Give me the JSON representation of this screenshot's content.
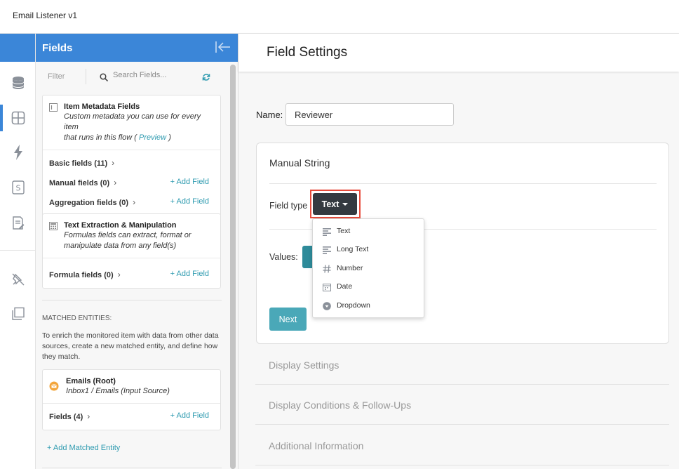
{
  "app": {
    "title": "Email Listener v1"
  },
  "colors": {
    "accent": "#3b86d8",
    "link": "#2f9bb0",
    "highlight": "#e74c3c",
    "dark_button": "#343a40",
    "teal_button": "#4aa8b8"
  },
  "rail": {
    "icons": [
      "database-icon",
      "table-icon",
      "lightning-icon",
      "s-box-icon",
      "edit-document-icon",
      "pin-off-icon",
      "copy-icon"
    ],
    "active": "table-icon"
  },
  "fields_panel": {
    "title": "Fields",
    "filter_label": "Filter",
    "search_placeholder": "Search Fields...",
    "metadata_card": {
      "title": "Item Metadata Fields",
      "desc_1": "Custom metadata you can use for every item",
      "desc_2a": "that runs in this flow (",
      "preview": "Preview",
      "desc_2b": ")",
      "rows": [
        {
          "label": "Basic fields (11)",
          "add": ""
        },
        {
          "label": "Manual fields (0)",
          "add": "+ Add Field"
        },
        {
          "label": "Aggregation fields (0)",
          "add": "+ Add Field"
        }
      ]
    },
    "text_card": {
      "title": "Text Extraction & Manipulation",
      "desc_1": "Formulas fields can extract, format or",
      "desc_2": "manipulate data from any field(s)",
      "row": {
        "label": "Formula fields (0)",
        "add": "+ Add Field"
      }
    },
    "matched": {
      "title": "MATCHED ENTITIES:",
      "desc": "To enrich the monitored item with data from other data sources, create a new matched entity, and define how they match.",
      "entity_title": "Emails (Root)",
      "entity_desc": "Inbox1 / Emails (Input Source)",
      "row": {
        "label": "Fields (4)",
        "add": "+ Add Field"
      },
      "add_matched": "+ Add Matched Entity"
    }
  },
  "settings": {
    "title": "Field Settings",
    "name_label": "Name:",
    "name_value": "Reviewer",
    "box_title": "Manual String",
    "field_type_label": "Field type",
    "field_type_value": "Text",
    "values_label": "Values:",
    "next_label": "Next",
    "type_options": [
      {
        "label": "Text",
        "icon": "text-lines-icon"
      },
      {
        "label": "Long Text",
        "icon": "long-text-icon"
      },
      {
        "label": "Number",
        "icon": "hash-icon"
      },
      {
        "label": "Date",
        "icon": "calendar-icon"
      },
      {
        "label": "Dropdown",
        "icon": "dropdown-circle-icon"
      }
    ],
    "accordions": [
      "Display Settings",
      "Display Conditions & Follow-Ups",
      "Additional Information"
    ]
  }
}
